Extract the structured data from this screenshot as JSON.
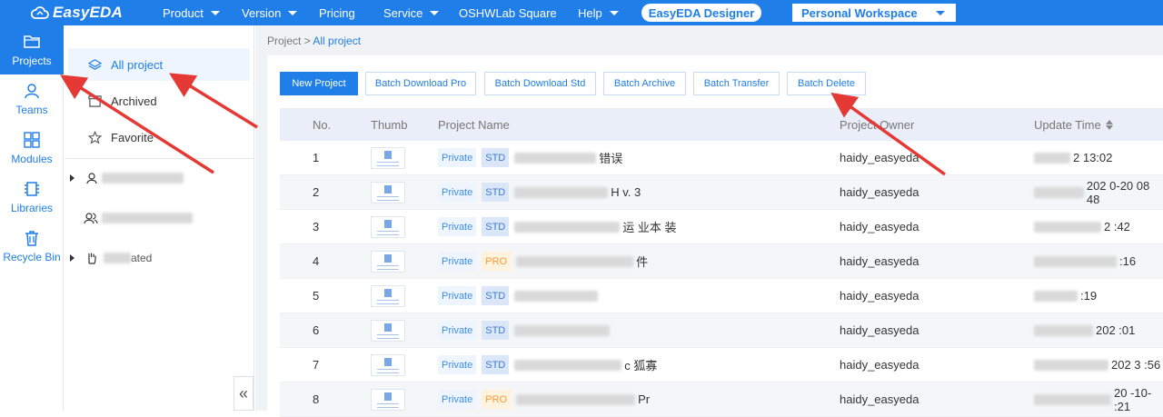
{
  "topbar": {
    "logo": "EasyEDA",
    "nav": [
      {
        "label": "Product",
        "dropdown": true
      },
      {
        "label": "Version",
        "dropdown": true
      },
      {
        "label": "Pricing",
        "dropdown": false
      },
      {
        "label": "Service",
        "dropdown": true
      },
      {
        "label": "OSHWLab Square",
        "dropdown": false
      },
      {
        "label": "Help",
        "dropdown": true
      }
    ],
    "designer_button": "EasyEDA Designer",
    "workspace": "Personal Workspace"
  },
  "rail": [
    {
      "label": "Projects",
      "icon": "folder-icon",
      "active": true
    },
    {
      "label": "Teams",
      "icon": "team-icon",
      "active": false
    },
    {
      "label": "Modules",
      "icon": "grid-icon",
      "active": false
    },
    {
      "label": "Libraries",
      "icon": "chip-icon",
      "active": false
    },
    {
      "label": "Recycle Bin",
      "icon": "trash-icon",
      "active": false
    }
  ],
  "panel": {
    "items": [
      {
        "label": "All project",
        "icon": "layers-icon",
        "active": true
      },
      {
        "label": "Archived",
        "icon": "archive-icon",
        "active": false
      },
      {
        "label": "Favorite",
        "icon": "star-icon",
        "active": false
      }
    ],
    "groups": [
      {
        "icon": "user-icon",
        "visible_text": ""
      },
      {
        "icon": "team-icon",
        "visible_text": ""
      },
      {
        "icon": "hand-icon",
        "visible_text": "ated"
      }
    ],
    "collapse": "«"
  },
  "breadcrumb": {
    "root": "Project",
    "sep": " > ",
    "current": "All project"
  },
  "toolbar": {
    "new_project": "New Project",
    "batch_download_pro": "Batch Download Pro",
    "batch_download_std": "Batch Download Std",
    "batch_archive": "Batch Archive",
    "batch_transfer": "Batch Transfer",
    "batch_delete": "Batch Delete"
  },
  "table": {
    "headers": {
      "no": "No.",
      "thumb": "Thumb",
      "name": "Project Name",
      "owner": "Project Owner",
      "time": "Update Time"
    },
    "rows": [
      {
        "no": "1",
        "visibility": "Private",
        "type": "STD",
        "name_visible": "错误",
        "owner": "haidy_easyeda",
        "time_visible": "2 13:02"
      },
      {
        "no": "2",
        "visibility": "Private",
        "type": "STD",
        "name_visible": "H v. 3",
        "owner": "haidy_easyeda",
        "time_visible": "202 0-20 08 48"
      },
      {
        "no": "3",
        "visibility": "Private",
        "type": "STD",
        "name_visible": "运 业本 装",
        "owner": "haidy_easyeda",
        "time_visible": "2 :42"
      },
      {
        "no": "4",
        "visibility": "Private",
        "type": "PRO",
        "name_visible": "件",
        "owner": "haidy_easyeda",
        "time_visible": ":16"
      },
      {
        "no": "5",
        "visibility": "Private",
        "type": "STD",
        "name_visible": "",
        "owner": "haidy_easyeda",
        "time_visible": ":19"
      },
      {
        "no": "6",
        "visibility": "Private",
        "type": "STD",
        "name_visible": "",
        "owner": "haidy_easyeda",
        "time_visible": "202 :01"
      },
      {
        "no": "7",
        "visibility": "Private",
        "type": "STD",
        "name_visible": "c 狐寡",
        "owner": "haidy_easyeda",
        "time_visible": "202 3 :56"
      },
      {
        "no": "8",
        "visibility": "Private",
        "type": "PRO",
        "name_visible": "Pr",
        "owner": "haidy_easyeda",
        "time_visible": "20 -10- :21"
      }
    ]
  },
  "colors": {
    "brand": "#1f7ee8",
    "arrow": "#e53935"
  }
}
